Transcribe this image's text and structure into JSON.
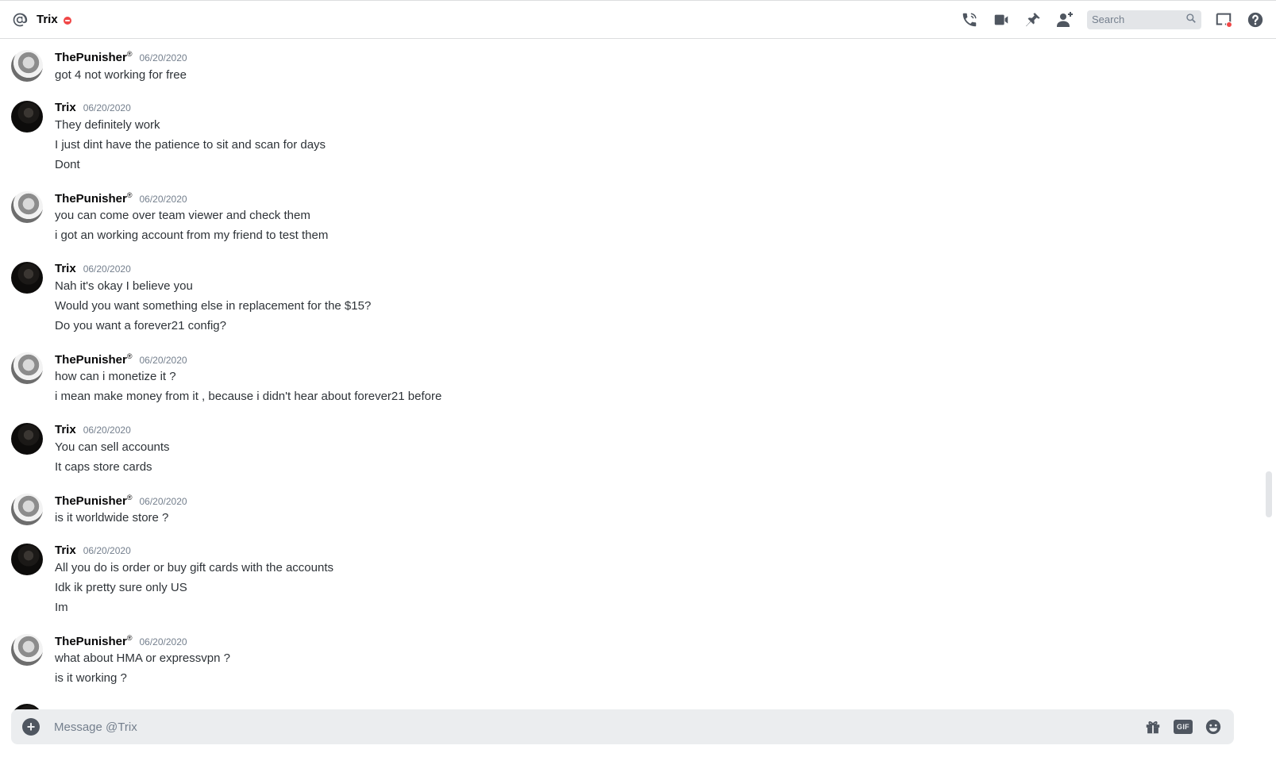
{
  "header": {
    "channel_name": "Trix",
    "status": "do-not-disturb",
    "search_placeholder": "Search",
    "icons": [
      "at-icon",
      "voice-call-icon",
      "video-call-icon",
      "pin-icon",
      "add-friend-icon",
      "search-icon",
      "inbox-icon",
      "help-icon"
    ]
  },
  "users": {
    "punisher": {
      "name": "ThePunisher",
      "badge": "®"
    },
    "trix": {
      "name": "Trix"
    }
  },
  "messages": [
    {
      "author": "ThePunisher",
      "timestamp": "06/20/2020",
      "lines": [
        "got 4 not working for free"
      ]
    },
    {
      "author": "Trix",
      "timestamp": "06/20/2020",
      "lines": [
        "They definitely work",
        "I just dint have the patience to sit and scan for days",
        "Dont"
      ]
    },
    {
      "author": "ThePunisher",
      "timestamp": "06/20/2020",
      "lines": [
        "you can come over team viewer and check them",
        "i got an working account from my friend to test them"
      ]
    },
    {
      "author": "Trix",
      "timestamp": "06/20/2020",
      "lines": [
        "Nah it's okay I believe you",
        "Would you want something else in replacement for the $15?",
        "Do you want a forever21 config?"
      ]
    },
    {
      "author": "ThePunisher",
      "timestamp": "06/20/2020",
      "lines": [
        "how can i monetize it ?",
        "i mean make money from it , because i didn't hear about forever21 before"
      ]
    },
    {
      "author": "Trix",
      "timestamp": "06/20/2020",
      "lines": [
        "You can sell accounts",
        "It caps store cards"
      ]
    },
    {
      "author": "ThePunisher",
      "timestamp": "06/20/2020",
      "lines": [
        "is it worldwide store ?"
      ]
    },
    {
      "author": "Trix",
      "timestamp": "06/20/2020",
      "lines": [
        "All you do is order or buy gift cards with the accounts",
        "Idk ik pretty sure only US",
        "Im"
      ]
    },
    {
      "author": "ThePunisher",
      "timestamp": "06/20/2020",
      "lines": [
        "what about HMA or expressvpn ?",
        "is it working ?"
      ]
    }
  ],
  "composer": {
    "placeholder": "Message @Trix",
    "gif_label": "GIF",
    "icons": [
      "add-attachment-icon",
      "gift-icon",
      "gif-icon",
      "emoji-icon"
    ]
  },
  "colors": {
    "dnd_red": "#f04747",
    "text_primary": "#2e3338",
    "text_muted": "#747f8d",
    "composer_bg": "#ebedef"
  }
}
